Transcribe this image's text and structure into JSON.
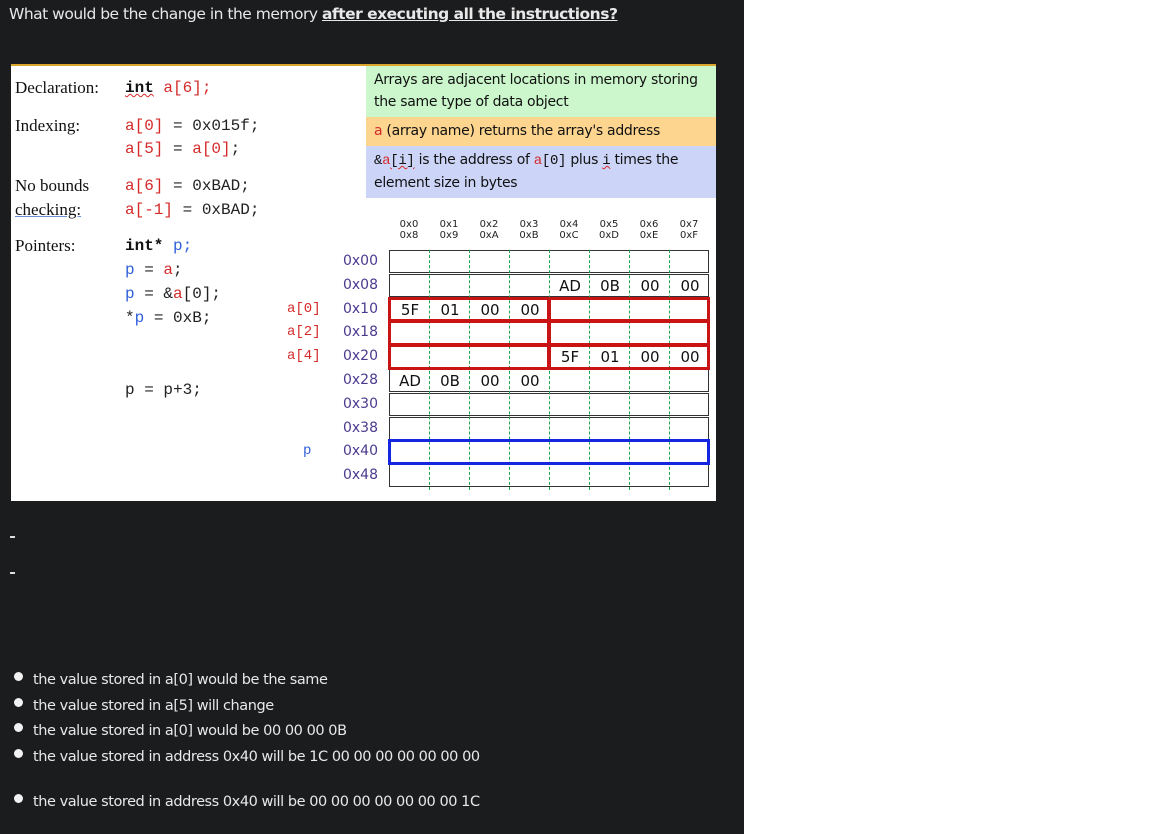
{
  "question": {
    "prefix": "What would be the change in the memory ",
    "emphasis": "after executing all the instructions?"
  },
  "slide": {
    "code": {
      "declaration_label": "Declaration:",
      "declaration_kw": "int",
      "declaration_arr": "a[6];",
      "indexing_label": "Indexing:",
      "idx1_lhs": "a[0]",
      "idx1_rhs": " = 0x015f;",
      "idx2_lhs": "a[5]",
      "idx2_eq": " = ",
      "idx2_rhs": "a[0]",
      "idx2_end": ";",
      "nobounds_label_1": "No bounds",
      "nobounds_label_2": "checking:",
      "nb1_lhs": "a[6]",
      "nb1_rhs": " = 0xBAD;",
      "nb2_lhs": "a[-1]",
      "nb2_rhs": " = 0xBAD;",
      "pointers_label": "Pointers:",
      "ptr_kw": "int*",
      "ptr_name": "p;",
      "p1_p": "p",
      "p1_eq": " = ",
      "p1_a": "a",
      "p1_end": ";",
      "p2_p": "p",
      "p2_eq": " = &",
      "p2_a": "a",
      "p2_end": "[0];",
      "p3_star": "*",
      "p3_p": "p",
      "p3_rest": " = 0xB;",
      "p4": "p = p+3;"
    },
    "notes": {
      "green": "Arrays are adjacent locations in memory storing the same type of data object",
      "orange_a": "a",
      "orange_rest": " (array name) returns the array's address",
      "blue_amp": "&",
      "blue_a": "a",
      "blue_i": "[i]",
      "blue_mid": " is the address of ",
      "blue_a0_a": "a",
      "blue_a0_idx": "[0]",
      "blue_plus": " plus ",
      "blue_i2": "i",
      "blue_end": " times the element size in bytes"
    },
    "colors": {
      "green_note": "#ccf7cc",
      "orange_note": "#fdd58f",
      "blue_note": "#ccd5f7",
      "array_box": "#c81414",
      "pointer_box": "#1426e0"
    },
    "memory": {
      "col_heads_top": [
        "0x0",
        "0x1",
        "0x2",
        "0x3",
        "0x4",
        "0x5",
        "0x6",
        "0x7"
      ],
      "col_heads_bottom": [
        "0x8",
        "0x9",
        "0xA",
        "0xB",
        "0xC",
        "0xD",
        "0xE",
        "0xF"
      ],
      "rows": [
        {
          "addr": "0x00",
          "label": "",
          "cells": [
            "",
            "",
            "",
            "",
            "",
            "",
            "",
            ""
          ]
        },
        {
          "addr": "0x08",
          "label": "",
          "cells": [
            "",
            "",
            "",
            "",
            "AD",
            "0B",
            "00",
            "00"
          ]
        },
        {
          "addr": "0x10",
          "label": "a[0]",
          "cells": [
            "5F",
            "01",
            "00",
            "00",
            "",
            "",
            "",
            ""
          ]
        },
        {
          "addr": "0x18",
          "label": "a[2]",
          "cells": [
            "",
            "",
            "",
            "",
            "",
            "",
            "",
            ""
          ]
        },
        {
          "addr": "0x20",
          "label": "a[4]",
          "cells": [
            "",
            "",
            "",
            "",
            "5F",
            "01",
            "00",
            "00"
          ]
        },
        {
          "addr": "0x28",
          "label": "",
          "cells": [
            "AD",
            "0B",
            "00",
            "00",
            "",
            "",
            "",
            ""
          ]
        },
        {
          "addr": "0x30",
          "label": "",
          "cells": [
            "",
            "",
            "",
            "",
            "",
            "",
            "",
            ""
          ]
        },
        {
          "addr": "0x38",
          "label": "",
          "cells": [
            "",
            "",
            "",
            "",
            "",
            "",
            "",
            ""
          ]
        },
        {
          "addr": "0x40",
          "label": "p",
          "cells": [
            "",
            "",
            "",
            "",
            "",
            "",
            "",
            ""
          ]
        },
        {
          "addr": "0x48",
          "label": "",
          "cells": [
            "",
            "",
            "",
            "",
            "",
            "",
            "",
            ""
          ]
        }
      ]
    }
  },
  "separators": [
    "-",
    "-"
  ],
  "options": [
    "the value stored in a[0] would be the same",
    "the value stored in a[5] will change",
    "the value stored in a[0] would be 00 00 00 0B",
    "the value stored in address 0x40 will be 1C 00 00 00 00 00 00 00",
    "the value stored in address 0x40 will be 00 00 00 00 00 00 00 1C"
  ]
}
